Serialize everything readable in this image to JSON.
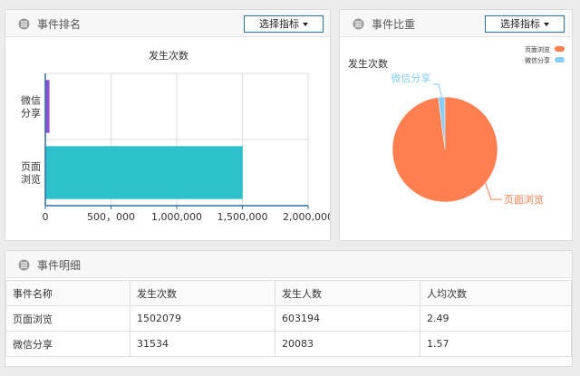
{
  "ranking": {
    "title": "事件排名",
    "select_label": "选择指标",
    "chart_data": {
      "type": "bar",
      "orientation": "horizontal",
      "title": "发生次数",
      "categories": [
        "微信分享",
        "页面浏览"
      ],
      "category_labels": [
        [
          "微信",
          "分享"
        ],
        [
          "页面",
          "浏览"
        ]
      ],
      "values": [
        31534,
        1502079
      ],
      "colors": [
        "#8e4fd4",
        "#2ec0cb"
      ],
      "xlim": [
        0,
        2000000
      ],
      "xticks": [
        0,
        500000,
        1000000,
        1500000,
        2000000
      ],
      "xtick_labels": [
        "0",
        "500，000",
        "1,000,000",
        "1,500,000",
        "2,000,000"
      ],
      "grid": true
    }
  },
  "ratio": {
    "title": "事件比重",
    "select_label": "选择指标",
    "chart_data": {
      "type": "pie",
      "title": "发生次数",
      "slices": [
        {
          "name": "页面浏览",
          "value": 1502079,
          "color": "#ff7f50"
        },
        {
          "name": "微信分享",
          "value": 31534,
          "color": "#87cefa"
        }
      ],
      "legend": [
        "页面浏览",
        "微信分享"
      ],
      "legend_position": "top-right"
    }
  },
  "detail": {
    "title": "事件明细",
    "columns": [
      "事件名称",
      "发生次数",
      "发生人数",
      "人均次数"
    ],
    "rows": [
      [
        "页面浏览",
        "1502079",
        "603194",
        "2.49"
      ],
      [
        "微信分享",
        "31534",
        "20083",
        "1.57"
      ]
    ]
  }
}
